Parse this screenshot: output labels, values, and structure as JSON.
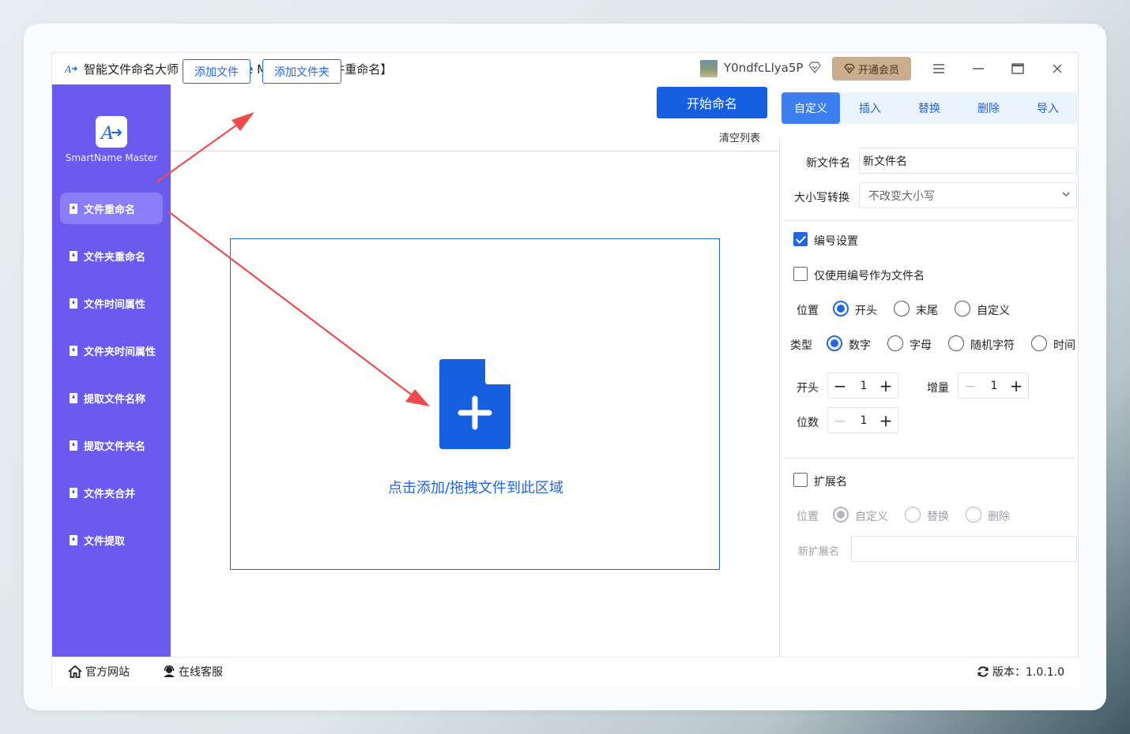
{
  "window": {
    "title": "智能文件命名大师 SmartName Master - 【文件重命名】",
    "username": "Y0ndfcLlya5P",
    "vip_label": "开通会员"
  },
  "sidebar": {
    "logo_text": "SmartName Master",
    "items": [
      {
        "label": "文件重命名",
        "active": true
      },
      {
        "label": "文件夹重命名"
      },
      {
        "label": "文件时间属性"
      },
      {
        "label": "文件夹时间属性"
      },
      {
        "label": "提取文件名称"
      },
      {
        "label": "提取文件夹名"
      },
      {
        "label": "文件夹合并"
      },
      {
        "label": "文件提取"
      }
    ]
  },
  "toolbar": {
    "add_file": "添加文件",
    "add_folder": "添加文件夹",
    "start_rename": "开始命名",
    "clear_list": "清空列表"
  },
  "dropzone": {
    "text": "点击添加/拖拽文件到此区域"
  },
  "tabs": [
    "自定义",
    "插入",
    "替换",
    "删除",
    "导入"
  ],
  "settings": {
    "new_name_label": "新文件名",
    "new_name_value": "新文件名",
    "case_label": "大小写转换",
    "case_value": "不改变大小写",
    "numbering_label": "编号设置",
    "numbering_checked": true,
    "only_number_label": "仅使用编号作为文件名",
    "only_number_checked": false,
    "position_label": "位置",
    "position_options": [
      "开头",
      "末尾",
      "自定义"
    ],
    "position_selected": "开头",
    "type_label": "类型",
    "type_options": [
      "数字",
      "字母",
      "随机字符",
      "时间"
    ],
    "type_selected": "数字",
    "start_label": "开头",
    "start_value": "1",
    "increment_label": "增量",
    "increment_value": "1",
    "digits_label": "位数",
    "digits_value": "1",
    "ext_label": "扩展名",
    "ext_checked": false,
    "ext_position_label": "位置",
    "ext_position_options": [
      "自定义",
      "替换",
      "删除"
    ],
    "ext_position_selected": "自定义",
    "new_ext_label": "新扩展名",
    "new_ext_value": ""
  },
  "footer": {
    "website": "官方网站",
    "support": "在线客服",
    "version": "版本：1.0.1.0"
  },
  "colors": {
    "sidebar": "#6a5af0",
    "primary": "#155fe0",
    "annotation_arrow": "#ef4b4b"
  }
}
